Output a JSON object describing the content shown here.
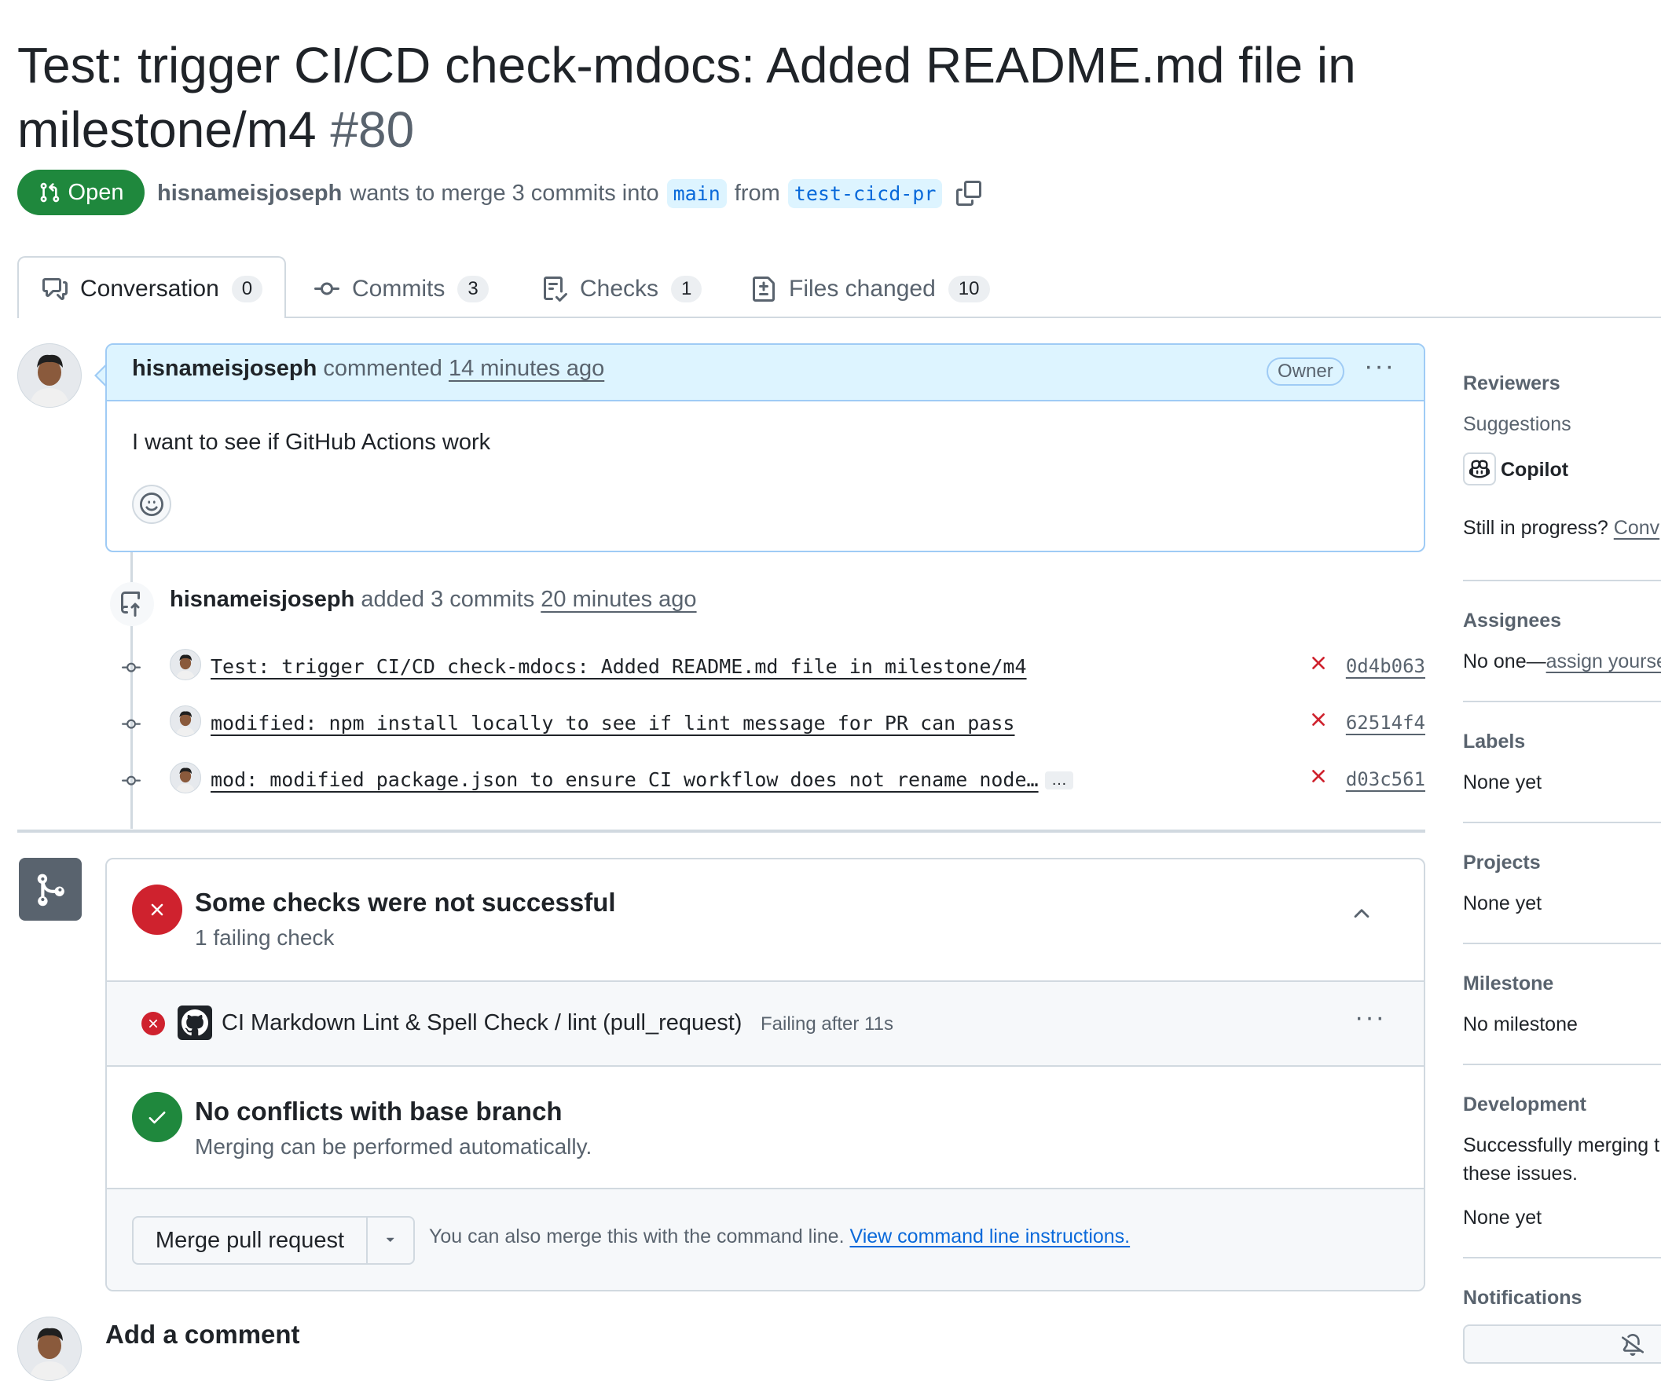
{
  "pr": {
    "title": "Test: trigger CI/CD check-mdocs: Added README.md file in milestone/m4",
    "number": "#80",
    "state": "Open",
    "author": "hisnameisjoseph",
    "merge_text": "wants to merge 3 commits into",
    "base_branch": "main",
    "from_text": "from",
    "head_branch": "test-cicd-pr"
  },
  "tabs": [
    {
      "label": "Conversation",
      "count": "0",
      "icon": "comment-discussion-icon"
    },
    {
      "label": "Commits",
      "count": "3",
      "icon": "git-commit-icon"
    },
    {
      "label": "Checks",
      "count": "1",
      "icon": "checklist-icon"
    },
    {
      "label": "Files changed",
      "count": "10",
      "icon": "file-diff-icon"
    }
  ],
  "comment": {
    "author": "hisnameisjoseph",
    "action": "commented",
    "time": "14 minutes ago",
    "badge": "Owner",
    "body": "I want to see if GitHub Actions work"
  },
  "push_event": {
    "author": "hisnameisjoseph",
    "action": "added 3 commits",
    "time": "20 minutes ago"
  },
  "commits": [
    {
      "message": "Test: trigger CI/CD check-mdocs: Added README.md file in milestone/m4",
      "sha": "0d4b063",
      "status": "failure"
    },
    {
      "message": "modified: npm install locally to see if lint message for PR can pass",
      "sha": "62514f4",
      "status": "failure"
    },
    {
      "message": "mod: modified package.json to ensure CI workflow does not rename node…",
      "sha": "d03c561",
      "status": "failure",
      "expander": "…"
    }
  ],
  "checks": {
    "title": "Some checks were not successful",
    "subtitle": "1 failing check",
    "item": {
      "name": "CI Markdown Lint & Spell Check / lint (pull_request)",
      "status": "Failing after 11s"
    }
  },
  "conflicts": {
    "title": "No conflicts with base branch",
    "subtitle": "Merging can be performed automatically."
  },
  "merge": {
    "button": "Merge pull request",
    "hint": "You can also merge this with the command line.",
    "link": "View command line instructions."
  },
  "add_comment": "Add a comment",
  "sidebar": {
    "reviewers": {
      "title": "Reviewers",
      "suggestions": "Suggestions",
      "copilot": "Copilot",
      "progress": "Still in progress?",
      "progress_link": "Conv"
    },
    "assignees": {
      "title": "Assignees",
      "text": "No one—",
      "link": "assign yourse"
    },
    "labels": {
      "title": "Labels",
      "value": "None yet"
    },
    "projects": {
      "title": "Projects",
      "value": "None yet"
    },
    "milestone": {
      "title": "Milestone",
      "value": "No milestone"
    },
    "development": {
      "title": "Development",
      "line1": "Successfully merging t",
      "line2": "these issues.",
      "value": "None yet"
    },
    "notifications": {
      "title": "Notifications"
    }
  },
  "colors": {
    "open_green": "#1f883d",
    "failure_red": "#cf222e",
    "link_blue": "#0969da",
    "comment_header": "#ddf4ff"
  }
}
